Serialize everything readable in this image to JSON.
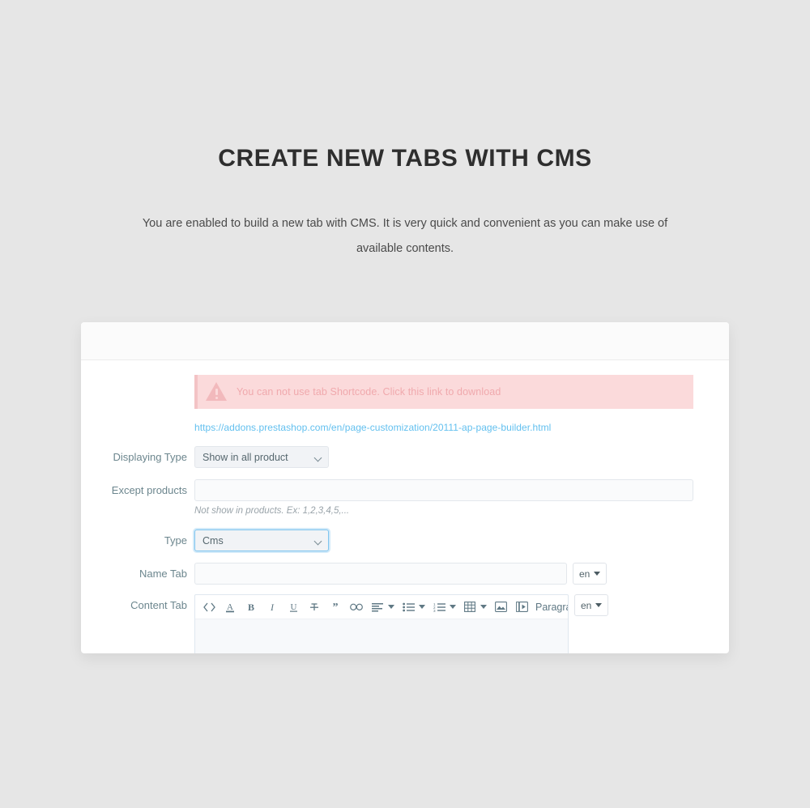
{
  "hero": {
    "title": "CREATE NEW TABS WITH CMS",
    "subtitle": "You are enabled to build a new tab with CMS. It is very quick and convenient as you can make use of available contents."
  },
  "panel": {
    "alert": {
      "icon": "warning-triangle-icon",
      "message": "You can not use tab Shortcode. Click this link to download",
      "bg_color": "#fbdadb",
      "text_color": "#f0a9ad"
    },
    "download_link": {
      "text": "https://addons.prestashop.com/en/page-customization/20111-ap-page-builder.html",
      "color": "#63c0ef"
    },
    "fields": {
      "displaying_type": {
        "label": "Displaying Type",
        "value": "Show in all product",
        "options": [
          "Show in all product"
        ]
      },
      "except_products": {
        "label": "Except products",
        "value": "",
        "placeholder": "",
        "hint": "Not show in products. Ex: 1,2,3,4,5,..."
      },
      "type": {
        "label": "Type",
        "value": "Cms",
        "options": [
          "Cms"
        ],
        "focused": true
      },
      "name_tab": {
        "label": "Name Tab",
        "value": "",
        "placeholder": "",
        "lang": "en"
      },
      "content_tab": {
        "label": "Content Tab",
        "lang": "en",
        "paragraph_label": "Paragraph"
      }
    },
    "toolbar": [
      {
        "name": "source-code-icon",
        "glyph": "<>"
      },
      {
        "name": "text-color-icon",
        "glyph": "A"
      },
      {
        "name": "bold-icon",
        "glyph": "B"
      },
      {
        "name": "italic-icon",
        "glyph": "I"
      },
      {
        "name": "underline-icon",
        "glyph": "U"
      },
      {
        "name": "strikethrough-icon",
        "glyph": "S"
      },
      {
        "name": "blockquote-icon",
        "glyph": "”"
      },
      {
        "name": "link-icon",
        "glyph": "link"
      },
      {
        "name": "align-left-icon",
        "glyph": "align"
      },
      {
        "name": "unordered-list-icon",
        "glyph": "ul"
      },
      {
        "name": "ordered-list-icon",
        "glyph": "ol"
      },
      {
        "name": "table-icon",
        "glyph": "table"
      },
      {
        "name": "image-icon",
        "glyph": "image"
      },
      {
        "name": "video-icon",
        "glyph": "video"
      }
    ]
  }
}
